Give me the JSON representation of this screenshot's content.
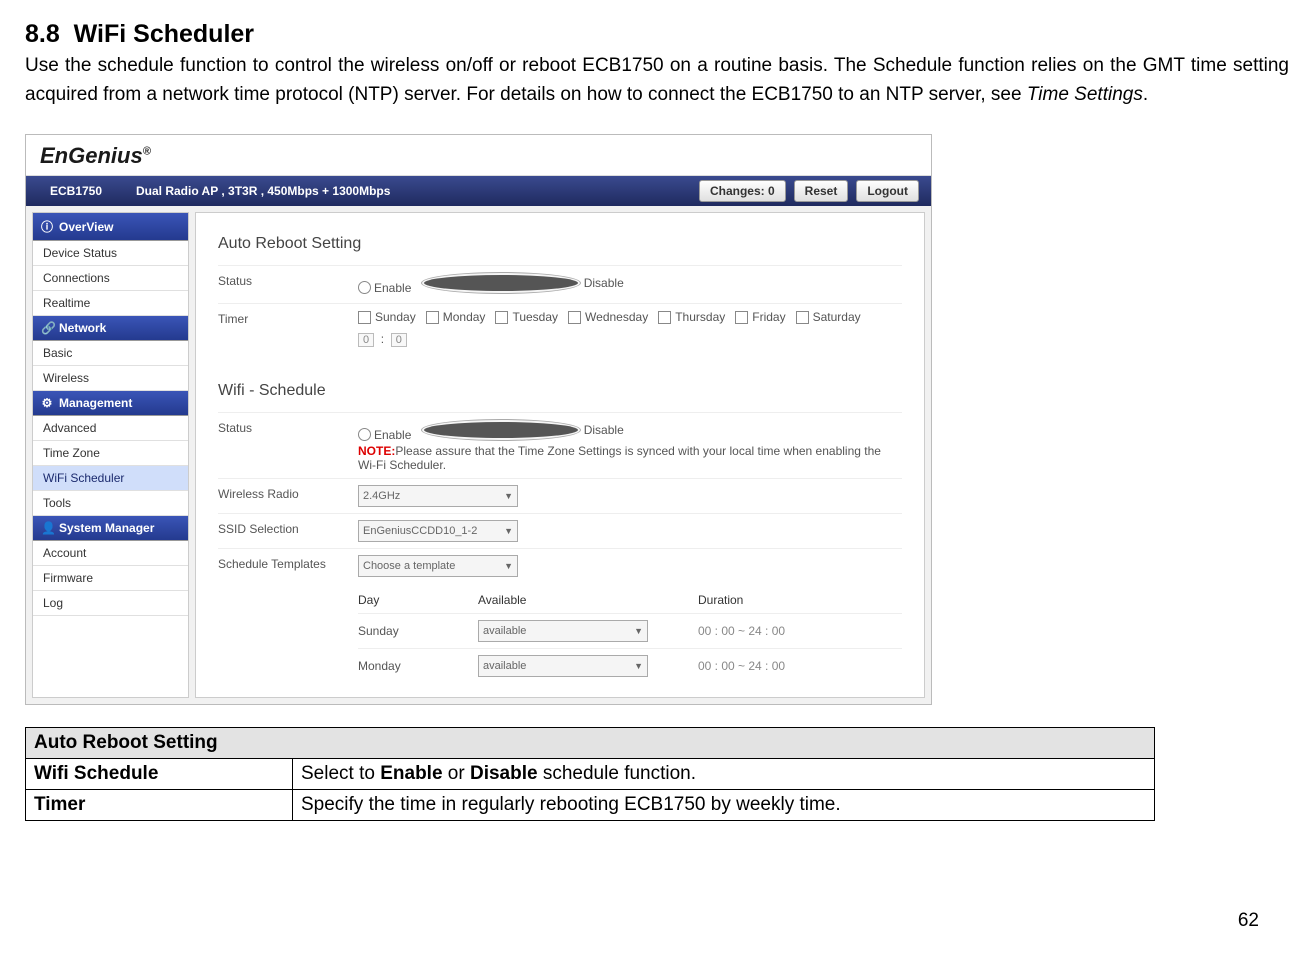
{
  "section": {
    "number": "8.8",
    "title": "WiFi Scheduler",
    "intro_1": "Use the schedule function to control the wireless on/off or reboot ECB1750 on a routine basis. The Schedule function relies on the GMT time setting acquired from a network time protocol (NTP) server. For details on how to connect the ECB1750 to an NTP server, see ",
    "intro_em": "Time Settings",
    "intro_2": "."
  },
  "router": {
    "logo": "EnGenius",
    "model": "ECB1750",
    "desc": "Dual Radio AP , 3T3R , 450Mbps + 1300Mbps",
    "top": {
      "changes": "Changes: 0",
      "reset": "Reset",
      "logout": "Logout"
    },
    "sidebar": {
      "h_overview": "OverView",
      "overview": [
        "Device Status",
        "Connections",
        "Realtime"
      ],
      "h_network": "Network",
      "network": [
        "Basic",
        "Wireless"
      ],
      "h_management": "Management",
      "management": [
        "Advanced",
        "Time Zone",
        "WiFi Scheduler",
        "Tools"
      ],
      "h_system": "System Manager",
      "system": [
        "Account",
        "Firmware",
        "Log"
      ]
    },
    "panel1": {
      "title": "Auto Reboot Setting",
      "status_label": "Status",
      "enable": "Enable",
      "disable": "Disable",
      "timer_label": "Timer",
      "days": [
        "Sunday",
        "Monday",
        "Tuesday",
        "Wednesday",
        "Thursday",
        "Friday",
        "Saturday"
      ],
      "hour": "0",
      "min": "0"
    },
    "panel2": {
      "title": "Wifi -  Schedule",
      "status_label": "Status",
      "enable": "Enable",
      "disable": "Disable",
      "note_prefix": "NOTE:",
      "note": "Please assure that the Time Zone Settings is synced with your local time when enabling the Wi-Fi Scheduler.",
      "radio_label": "Wireless Radio",
      "radio_value": "2.4GHz",
      "ssid_label": "SSID Selection",
      "ssid_value": "EnGeniusCCDD10_1-2",
      "tpl_label": "Schedule Templates",
      "tpl_value": "Choose a template",
      "h_day": "Day",
      "h_avail": "Available",
      "h_dur": "Duration",
      "rows": [
        {
          "day": "Sunday",
          "avail": "available",
          "dur": "00 : 00 ~ 24 : 00"
        },
        {
          "day": "Monday",
          "avail": "available",
          "dur": "00 : 00 ~ 24 : 00"
        }
      ]
    }
  },
  "table": {
    "header": "Auto Reboot Setting",
    "rows": [
      {
        "k": "Wifi Schedule",
        "v_pre": "Select to ",
        "b1": "Enable",
        "mid": " or ",
        "b2": "Disable",
        "v_post": " schedule function."
      },
      {
        "k": "Timer",
        "plain": "Specify the time in regularly rebooting ECB1750 by weekly time."
      }
    ]
  },
  "page_num": "62"
}
